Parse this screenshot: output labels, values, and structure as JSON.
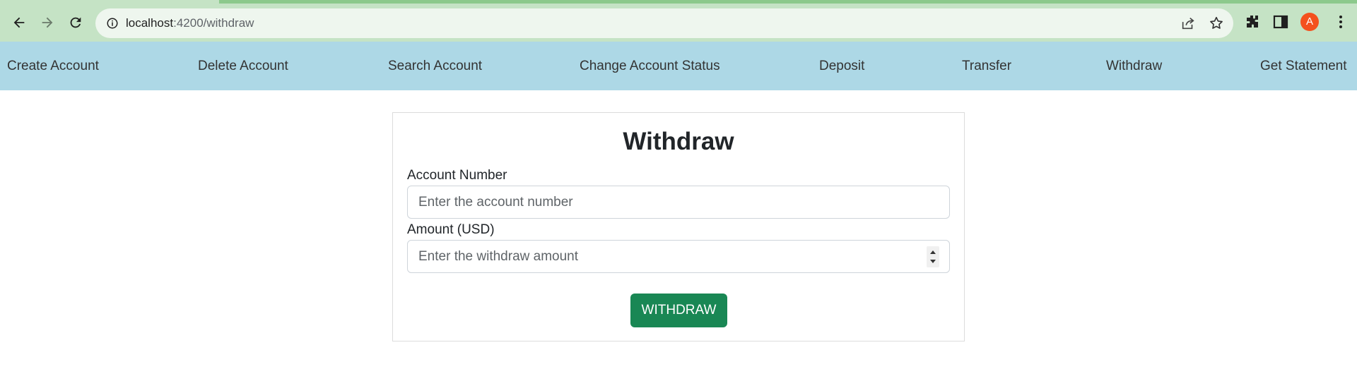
{
  "browser": {
    "url_host": "localhost",
    "url_path": ":4200/withdraw",
    "profile_initial": "A"
  },
  "nav": {
    "items": [
      {
        "label": "Create Account"
      },
      {
        "label": "Delete Account"
      },
      {
        "label": "Search Account"
      },
      {
        "label": "Change Account Status"
      },
      {
        "label": "Deposit"
      },
      {
        "label": "Transfer"
      },
      {
        "label": "Withdraw"
      },
      {
        "label": "Get Statement"
      }
    ]
  },
  "form": {
    "title": "Withdraw",
    "account_label": "Account Number",
    "account_placeholder": "Enter the account number",
    "account_value": "",
    "amount_label": "Amount (USD)",
    "amount_placeholder": "Enter the withdraw amount",
    "amount_value": "",
    "submit_label": "WITHDRAW"
  },
  "colors": {
    "chrome_bg": "#c5e3c5",
    "nav_bg": "#add8e6",
    "button_bg": "#198754",
    "avatar_bg": "#f4511e"
  },
  "icons": {
    "back": "back-arrow-icon",
    "forward": "forward-arrow-icon",
    "reload": "reload-icon",
    "site_info": "info-icon",
    "share": "share-icon",
    "bookmark": "star-icon",
    "extensions": "puzzle-icon",
    "side_panel": "side-panel-icon",
    "menu": "kebab-menu-icon"
  }
}
